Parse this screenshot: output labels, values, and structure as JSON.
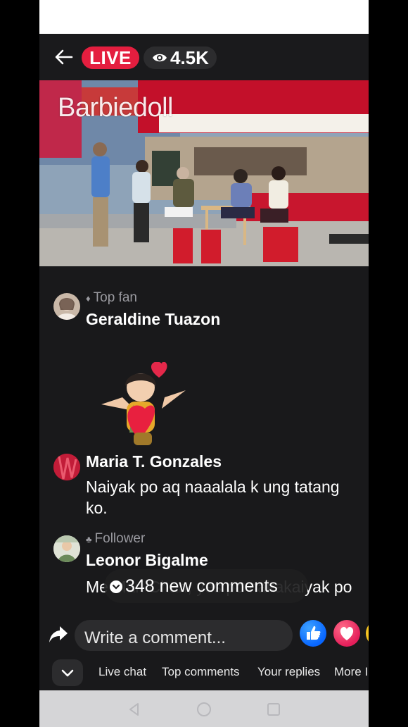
{
  "header": {
    "live_label": "LIVE",
    "viewer_count": "4.5K"
  },
  "video": {
    "caption": "Barbiedoll"
  },
  "new_comments": {
    "label": "348 new comments"
  },
  "comments": [
    {
      "badge": "Top fan",
      "author": "Geraldine Tuazon",
      "text": ""
    },
    {
      "badge": "",
      "author": "Maria T. Gonzales",
      "text": "Naiyak po aq naaalala k ung tatang ko."
    },
    {
      "badge": "Follower",
      "author": "Leonor Bigalme",
      "text": "Me  Mari Chan, yes po nakakaiyak po"
    }
  ],
  "composer": {
    "placeholder": "Write a comment..."
  },
  "tabs": [
    "Live chat",
    "Top comments",
    "Your replies",
    "More I"
  ],
  "colors": {
    "live_red": "#e41e3f",
    "background": "#19191b",
    "like_blue": "#0866ff",
    "love_pink": "#e41e5a"
  }
}
